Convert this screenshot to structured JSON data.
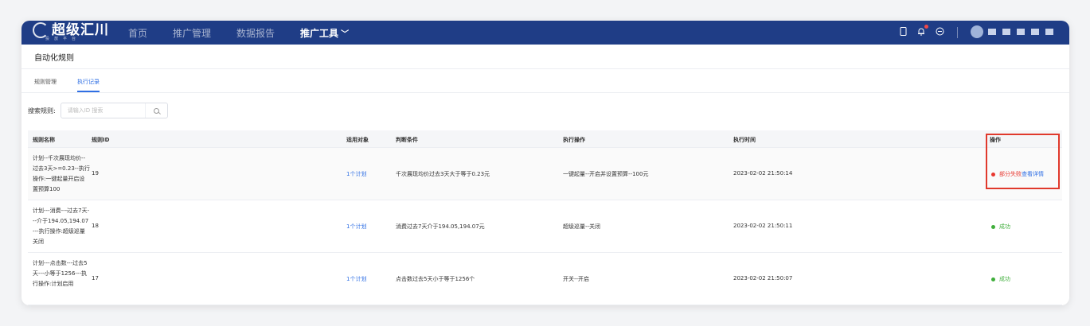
{
  "header": {
    "logo_text": "超级汇川",
    "logo_sub": "投放平台",
    "nav": [
      {
        "label": "首页"
      },
      {
        "label": "推广管理"
      },
      {
        "label": "数据报告"
      },
      {
        "label": "推广工具"
      }
    ],
    "nav_chevron": "﹀"
  },
  "page": {
    "title": "自动化规则",
    "tabs": [
      {
        "label": "规则管理"
      },
      {
        "label": "执行记录"
      }
    ]
  },
  "search": {
    "label": "搜索规则:",
    "placeholder": "请输入ID 搜索"
  },
  "table": {
    "columns": [
      "规则名称",
      "规则ID",
      "适用对象",
      "判断条件",
      "执行操作",
      "执行时间",
      "操作"
    ],
    "rows": [
      {
        "name": "计划--千次展现均价--过去3天>=0.23--执行操作:一键起量开启设置预算100",
        "id": "19",
        "target": "1个计划",
        "condition": "千次展现均价过去3天大于等于0.23元",
        "action": "一键起量--开启并设置预算--100元",
        "time": "2023-02-02 21:50:14",
        "status": "部分失败",
        "detail": "查看详情"
      },
      {
        "name": "计划---消费---过去7天---介于194.05,194.07---执行操作:超级巡量关闭",
        "id": "18",
        "target": "1个计划",
        "condition": "消费过去7天介于194.05,194.07元",
        "action": "超级巡量--关闭",
        "time": "2023-02-02 21:50:11",
        "status": "成功",
        "detail": ""
      },
      {
        "name": "计划---点击数---过去5天---小等于1256---执行操作:计划启用",
        "id": "17",
        "target": "1个计划",
        "condition": "点击数过去5天小于等于1256个",
        "action": "开关--开启",
        "time": "2023-02-02 21:50:07",
        "status": "成功",
        "detail": ""
      }
    ]
  },
  "colors": {
    "header_bg": "#1f3d86",
    "accent": "#2f6fe4",
    "fail": "#e8372f",
    "success": "#3fae3b",
    "highlight": "#e0392c"
  }
}
